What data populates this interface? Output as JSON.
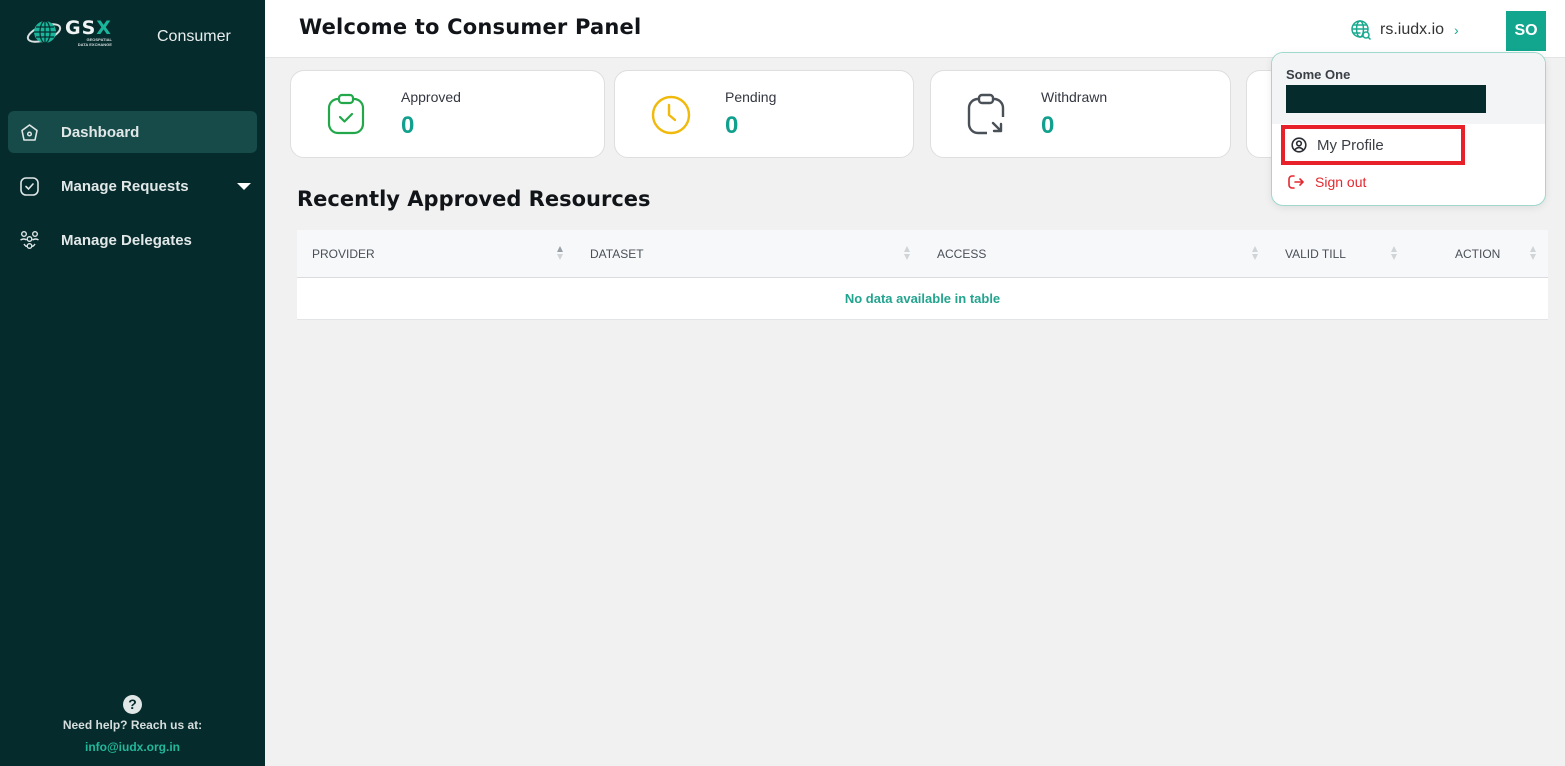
{
  "sidebar": {
    "logo": {
      "name": "GSX",
      "subtitle_line1": "GEOSPATIAL",
      "subtitle_line2": "DATA EXCHANGE"
    },
    "role": "Consumer",
    "items": [
      {
        "label": "Dashboard",
        "icon": "home-icon",
        "active": true
      },
      {
        "label": "Manage Requests",
        "icon": "check-square-icon",
        "has_submenu": true
      },
      {
        "label": "Manage Delegates",
        "icon": "people-group-icon"
      }
    ],
    "help": {
      "icon": "question-icon",
      "text": "Need help? Reach us at:",
      "email": "info@iudx.org.in"
    }
  },
  "header": {
    "title": "Welcome to Consumer Panel",
    "server": {
      "label": "rs.iudx.io",
      "icon": "globe-search-icon"
    },
    "avatar_initials": "SO"
  },
  "stats": [
    {
      "label": "Approved",
      "value": "0",
      "icon": "clipboard-check-icon",
      "color": "#22a84a"
    },
    {
      "label": "Pending",
      "value": "0",
      "icon": "clock-icon",
      "color": "#f0b90b"
    },
    {
      "label": "Withdrawn",
      "value": "0",
      "icon": "clipboard-arrow-icon",
      "color": "#4a5058"
    }
  ],
  "section": {
    "title": "Recently Approved Resources",
    "columns": [
      "PROVIDER",
      "DATASET",
      "ACCESS",
      "VALID TILL",
      "ACTION"
    ],
    "empty_message": "No data available in table"
  },
  "user_menu": {
    "name": "Some One",
    "items": [
      {
        "label": "My Profile",
        "icon": "user-circle-icon"
      },
      {
        "label": "Sign out",
        "icon": "sign-out-icon"
      }
    ]
  },
  "colors": {
    "sidebar_bg": "#062b2c",
    "accent": "#12a68e",
    "danger": "#e3282f",
    "highlight_box": "#e8202a"
  }
}
